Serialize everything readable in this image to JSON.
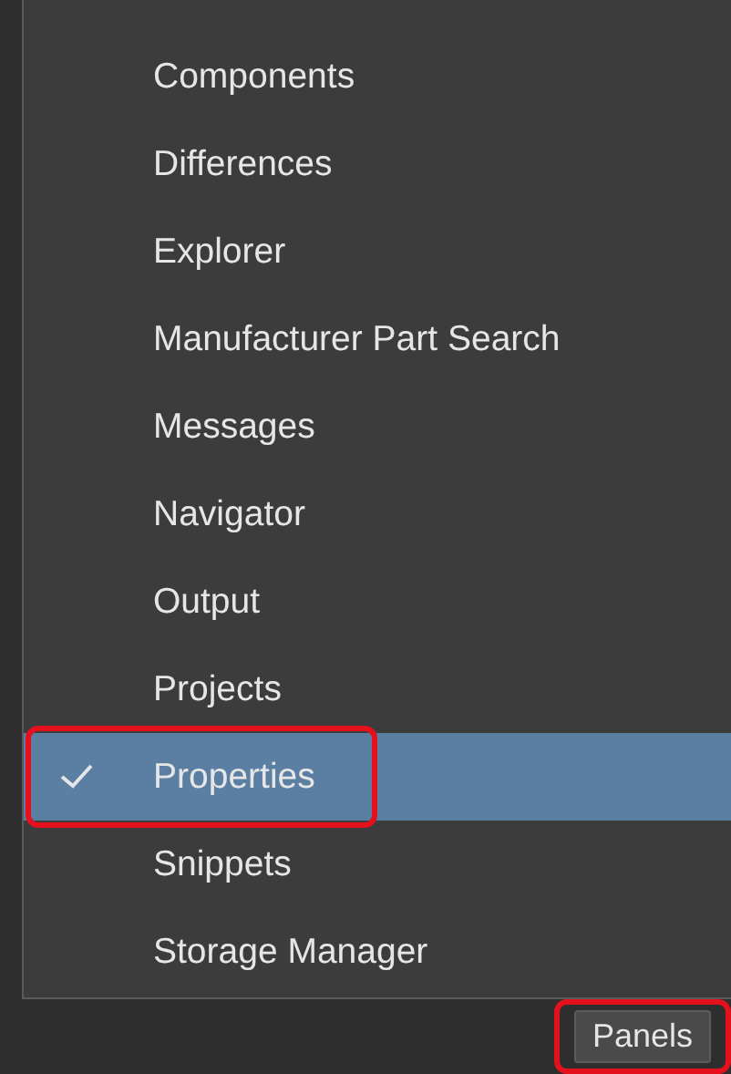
{
  "menu": {
    "items": [
      {
        "label": "Components",
        "selected": false,
        "outlined": false
      },
      {
        "label": "Differences",
        "selected": false,
        "outlined": false
      },
      {
        "label": "Explorer",
        "selected": false,
        "outlined": false
      },
      {
        "label": "Manufacturer Part Search",
        "selected": false,
        "outlined": false
      },
      {
        "label": "Messages",
        "selected": false,
        "outlined": false
      },
      {
        "label": "Navigator",
        "selected": false,
        "outlined": false
      },
      {
        "label": "Output",
        "selected": false,
        "outlined": false
      },
      {
        "label": "Projects",
        "selected": false,
        "outlined": false
      },
      {
        "label": "Properties",
        "selected": true,
        "outlined": true
      },
      {
        "label": "Snippets",
        "selected": false,
        "outlined": false
      },
      {
        "label": "Storage Manager",
        "selected": false,
        "outlined": false
      }
    ]
  },
  "status_bar": {
    "button": {
      "label": "Panels",
      "outlined": true
    }
  }
}
